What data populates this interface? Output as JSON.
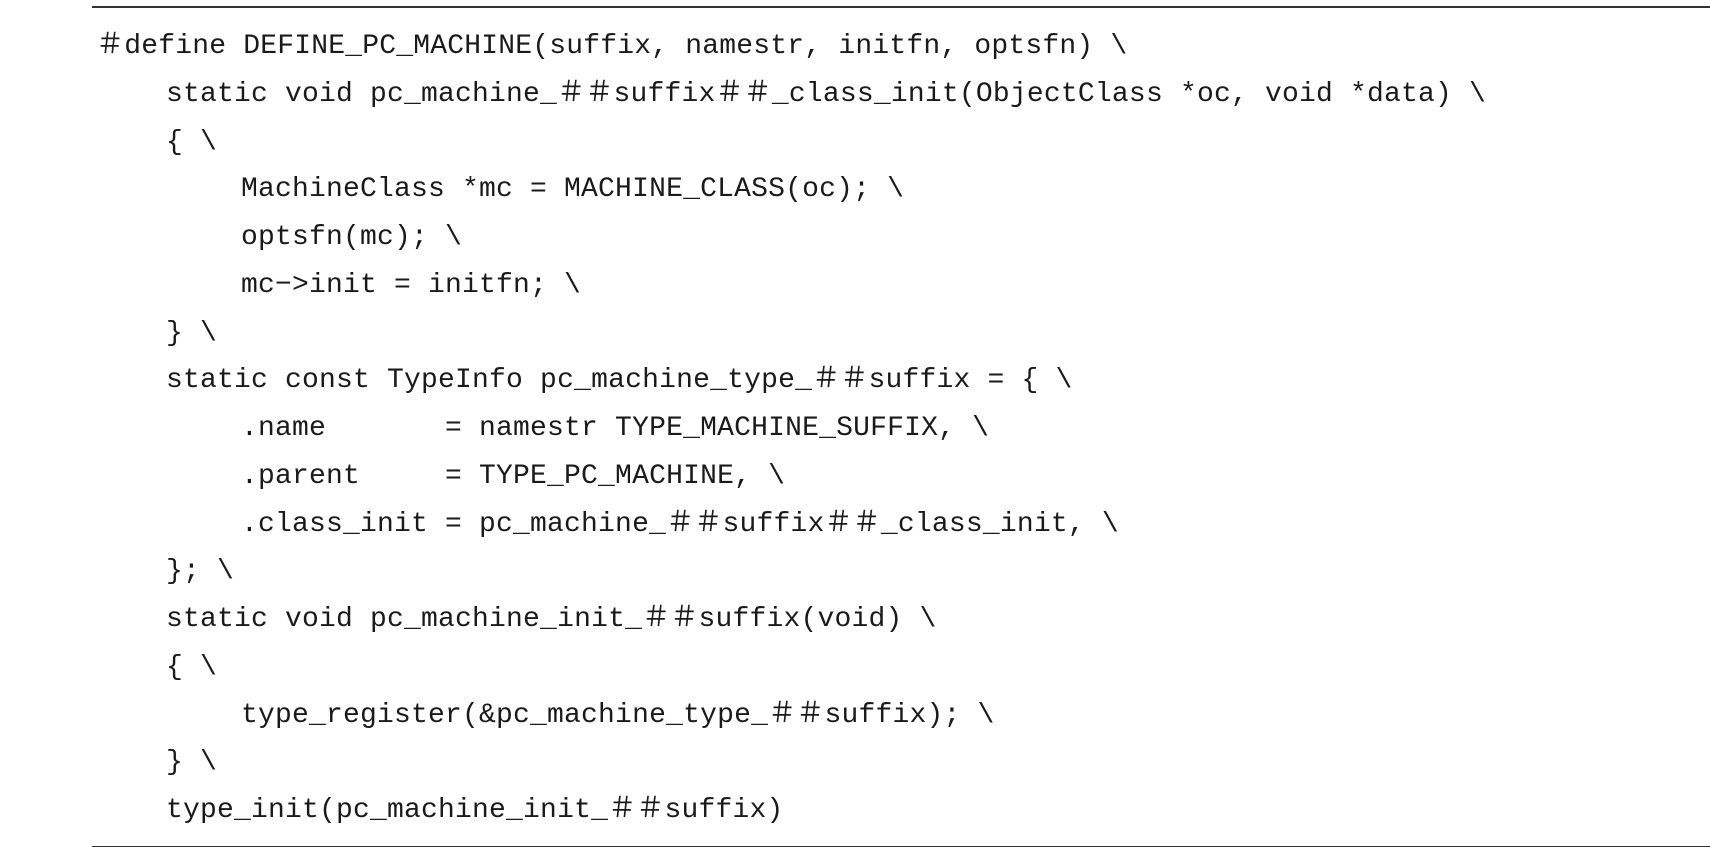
{
  "code_listing": {
    "lines": [
      {
        "indent": 0,
        "text": "＃define DEFINE_PC_MACHINE(suffix, namestr, initfn, optsfn) \\"
      },
      {
        "indent": 1,
        "text": "static void pc_machine_＃＃suffix＃＃_class_init(ObjectClass *oc, void *data) \\"
      },
      {
        "indent": 1,
        "text": "{ \\"
      },
      {
        "indent": 2,
        "text": "MachineClass *mc = MACHINE_CLASS(oc); \\"
      },
      {
        "indent": 2,
        "text": "optsfn(mc); \\"
      },
      {
        "indent": 2,
        "text": "mc−>init = initfn; \\"
      },
      {
        "indent": 1,
        "text": "} \\"
      },
      {
        "indent": 1,
        "text": "static const TypeInfo pc_machine_type_＃＃suffix = { \\"
      },
      {
        "indent": 2,
        "text": ".name       = namestr TYPE_MACHINE_SUFFIX, \\"
      },
      {
        "indent": 2,
        "text": ".parent     = TYPE_PC_MACHINE, \\"
      },
      {
        "indent": 2,
        "text": ".class_init = pc_machine_＃＃suffix＃＃_class_init, \\"
      },
      {
        "indent": 1,
        "text": "}; \\"
      },
      {
        "indent": 1,
        "text": "static void pc_machine_init_＃＃suffix(void) \\"
      },
      {
        "indent": 1,
        "text": "{ \\"
      },
      {
        "indent": 2,
        "text": "type_register(&pc_machine_type_＃＃suffix); \\"
      },
      {
        "indent": 1,
        "text": "} \\"
      },
      {
        "indent": 1,
        "text": "type_init(pc_machine_init_＃＃suffix)"
      }
    ]
  }
}
